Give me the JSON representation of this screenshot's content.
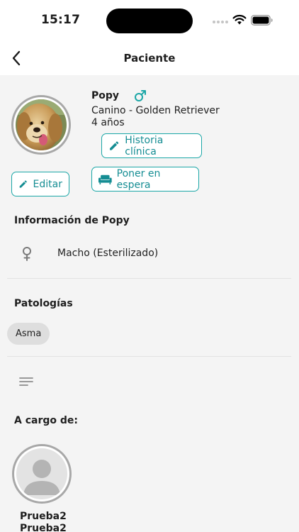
{
  "status_bar": {
    "time": "15:17"
  },
  "nav": {
    "title": "Paciente"
  },
  "patient": {
    "name": "Popy",
    "breed": "Canino - Golden Retriever",
    "age": "4 años"
  },
  "actions": {
    "historia_label": "Historia clínica",
    "espera_label": "Poner en espera",
    "editar_label": "Editar"
  },
  "info": {
    "title": "Información de Popy",
    "gender": "Macho (Esterilizado)"
  },
  "pathologies": {
    "title": "Patologías",
    "items": [
      "Asma"
    ]
  },
  "in_charge": {
    "title": "A cargo de:",
    "name_line1": "Prueba2",
    "name_line2": "Prueba2"
  },
  "colors": {
    "accent": "#1aa6a6",
    "accent_text": "#158d93",
    "background": "#f4f4f4"
  }
}
